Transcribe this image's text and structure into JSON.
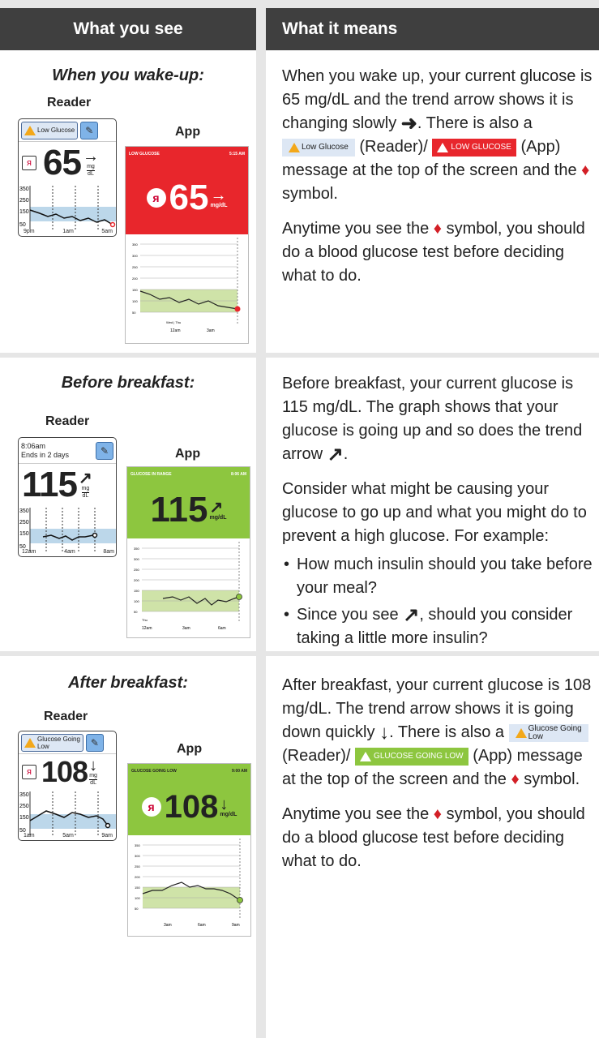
{
  "header": {
    "left": "What you see",
    "right": "What it means"
  },
  "rows": [
    {
      "title": "When you wake-up:",
      "reader_label": "Reader",
      "app_label": "App",
      "reader": {
        "badge": "Low Glucose",
        "value": "65",
        "arrow": "→",
        "unit_top": "mg",
        "unit_bottom": "dL",
        "yticks": [
          "350",
          "250",
          "150",
          "50"
        ],
        "xticks": [
          "9pm",
          "1am",
          "5am"
        ]
      },
      "app": {
        "bar_left": "LOW GLUCOSE",
        "bar_right": "5:15 AM",
        "value": "65",
        "arrow": "→",
        "unit": "mg/dL",
        "xticks": [
          "12am",
          "3am"
        ],
        "day_labels": "Wed | Thu",
        "color": "#e8262c"
      },
      "text": {
        "p1a": "When you wake up, your current glucose is 65 mg/dL and the trend arrow shows it is changing slowly",
        "p1b": ". There is also a",
        "badge": "Low Glucose",
        "p1c": "(Reader)/",
        "app_badge": "LOW GLUCOSE",
        "p1d": "(App) message at the top of the screen and the",
        "p1e": "symbol.",
        "p2a": "Anytime you see the",
        "p2b": "symbol, you should do a blood glucose test before deciding what to do."
      }
    },
    {
      "title": "Before breakfast:",
      "reader_label": "Reader",
      "app_label": "App",
      "reader": {
        "time": "8:06am",
        "ends": "Ends in 2 days",
        "value": "115",
        "arrow": "↗",
        "unit_top": "mg",
        "unit_bottom": "dL",
        "yticks": [
          "350",
          "250",
          "150",
          "50"
        ],
        "xticks": [
          "12am",
          "4am",
          "8am"
        ]
      },
      "app": {
        "bar_left": "GLUCOSE IN RANGE",
        "bar_right": "8:06 AM",
        "value": "115",
        "arrow": "↗",
        "unit": "mg/dL",
        "xticks": [
          "12am",
          "3am",
          "6am"
        ],
        "day_labels": "Thu",
        "color": "#8dc63f"
      },
      "text": {
        "p1a": "Before breakfast, your current glucose is 115 mg/dL. The graph shows that your glucose is going up and so does the trend arrow",
        "p1b": ".",
        "p2": "Consider what might be causing your glucose to go up and what you might do to prevent a high glucose. For example:",
        "b1": "How much insulin should you take before your meal?",
        "b2a": "Since you see",
        "b2b": ", should you consider taking a little more insulin?"
      }
    },
    {
      "title": "After breakfast:",
      "reader_label": "Reader",
      "app_label": "App",
      "reader": {
        "badge_l1": "Glucose Going",
        "badge_l2": "Low",
        "value": "108",
        "arrow": "↓",
        "unit_top": "mg",
        "unit_bottom": "dL",
        "yticks": [
          "350",
          "250",
          "150",
          "50"
        ],
        "xticks": [
          "1am",
          "5am",
          "9am"
        ]
      },
      "app": {
        "bar_left": "GLUCOSE GOING LOW",
        "bar_right": "9:00 AM",
        "value": "108",
        "arrow": "↓",
        "unit": "mg/dL",
        "xticks": [
          "3am",
          "6am",
          "9am"
        ],
        "color": "#8dc63f"
      },
      "text": {
        "p1a": "After breakfast, your current glucose is 108 mg/dL. The trend arrow shows it is going down quickly",
        "p1b": ". There is also a",
        "badge_l1": "Glucose Going",
        "badge_l2": "Low",
        "p1c": "(Reader)/",
        "app_badge": "GLUCOSE GOING LOW",
        "p1d": "(App) message at the top of the screen and the",
        "p1e": "symbol.",
        "p2a": "Anytime you see the",
        "p2b": "symbol, you should do a blood glucose test before deciding what to do."
      }
    }
  ],
  "app_yticks": [
    "350",
    "300",
    "250",
    "200",
    "150",
    "100",
    "50"
  ],
  "app_ylabel": "mg/dL"
}
